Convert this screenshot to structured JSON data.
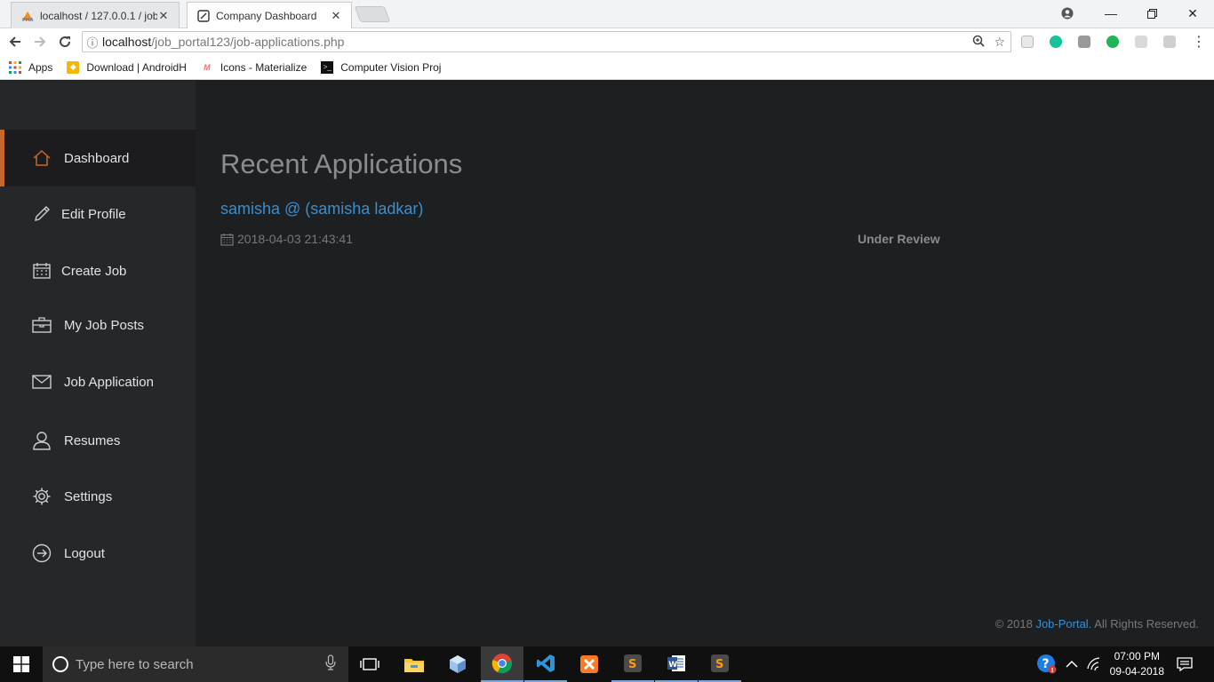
{
  "browser": {
    "tabs": [
      {
        "title": "localhost / 127.0.0.1 / job",
        "favicon": "phpmyadmin-icon"
      },
      {
        "title": "Company Dashboard",
        "favicon": "page-icon"
      }
    ],
    "url": {
      "host": "localhost",
      "path": "/job_portal123/job-applications.php"
    },
    "bookmarks": [
      {
        "label": "Apps",
        "icon": "apps-grid-icon"
      },
      {
        "label": "Download | AndroidH",
        "icon": "download-bookmark-icon"
      },
      {
        "label": "Icons - Materialize",
        "icon": "materialize-icon"
      },
      {
        "label": "Computer Vision Proj",
        "icon": "terminal-icon"
      }
    ]
  },
  "sidebar": {
    "items": [
      {
        "label": "Dashboard",
        "icon": "home-icon",
        "active": true
      },
      {
        "label": "Edit Profile",
        "icon": "pencil-icon"
      },
      {
        "label": "Create Job",
        "icon": "calendar-icon"
      },
      {
        "label": "My Job Posts",
        "icon": "briefcase-icon"
      },
      {
        "label": "Job Application",
        "icon": "envelope-icon"
      },
      {
        "label": "Resumes",
        "icon": "user-icon"
      },
      {
        "label": "Settings",
        "icon": "gear-icon"
      },
      {
        "label": "Logout",
        "icon": "logout-icon"
      }
    ]
  },
  "main": {
    "heading": "Recent Applications",
    "applications": [
      {
        "name": "samisha @ (samisha ladkar)",
        "date": "2018-04-03 21:43:41",
        "status": "Under Review"
      }
    ]
  },
  "footer": {
    "prefix": "© 2018",
    "link": "Job-Portal.",
    "suffix": "All Rights Reserved."
  },
  "taskbar": {
    "search_placeholder": "Type here to search",
    "time": "07:00 PM",
    "date": "09-04-2018"
  },
  "colors": {
    "accent": "#c4682b",
    "link": "#3a8fcf",
    "sidebar_bg": "#262729",
    "page_bg": "#1e1f21"
  }
}
